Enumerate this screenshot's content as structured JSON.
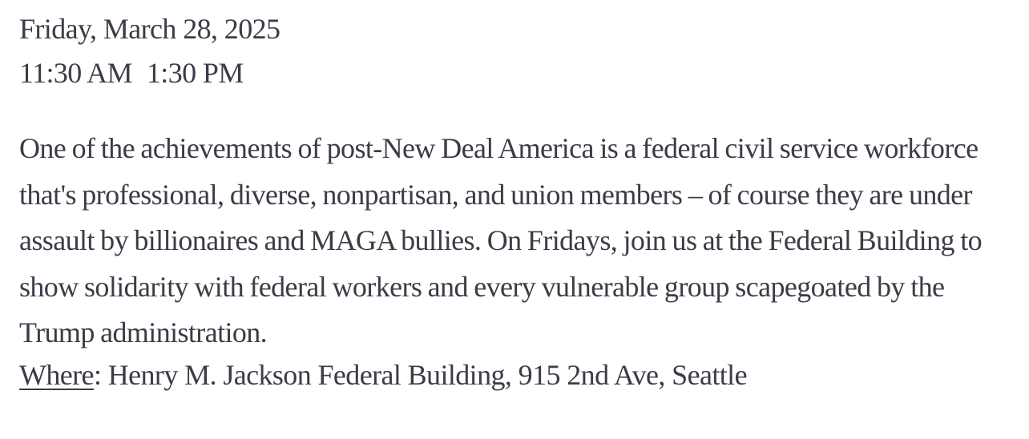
{
  "event": {
    "date": "Friday, March 28, 2025",
    "start_time": "11:30 AM",
    "end_time": "1:30 PM",
    "description": "One of the achievements of post-New Deal America is a federal civil service workforce that's professional, diverse, nonpartisan, and union members – of course they are under assault by billionaires and MAGA bullies. On Fridays, join us at the Federal Building to show solidarity with federal workers and every vulnerable group scapegoated by the Trump administration.",
    "where_label": "Where",
    "where_separator": ":",
    "location": "Henry M. Jackson Federal Building, 915 2nd Ave, Seattle"
  }
}
